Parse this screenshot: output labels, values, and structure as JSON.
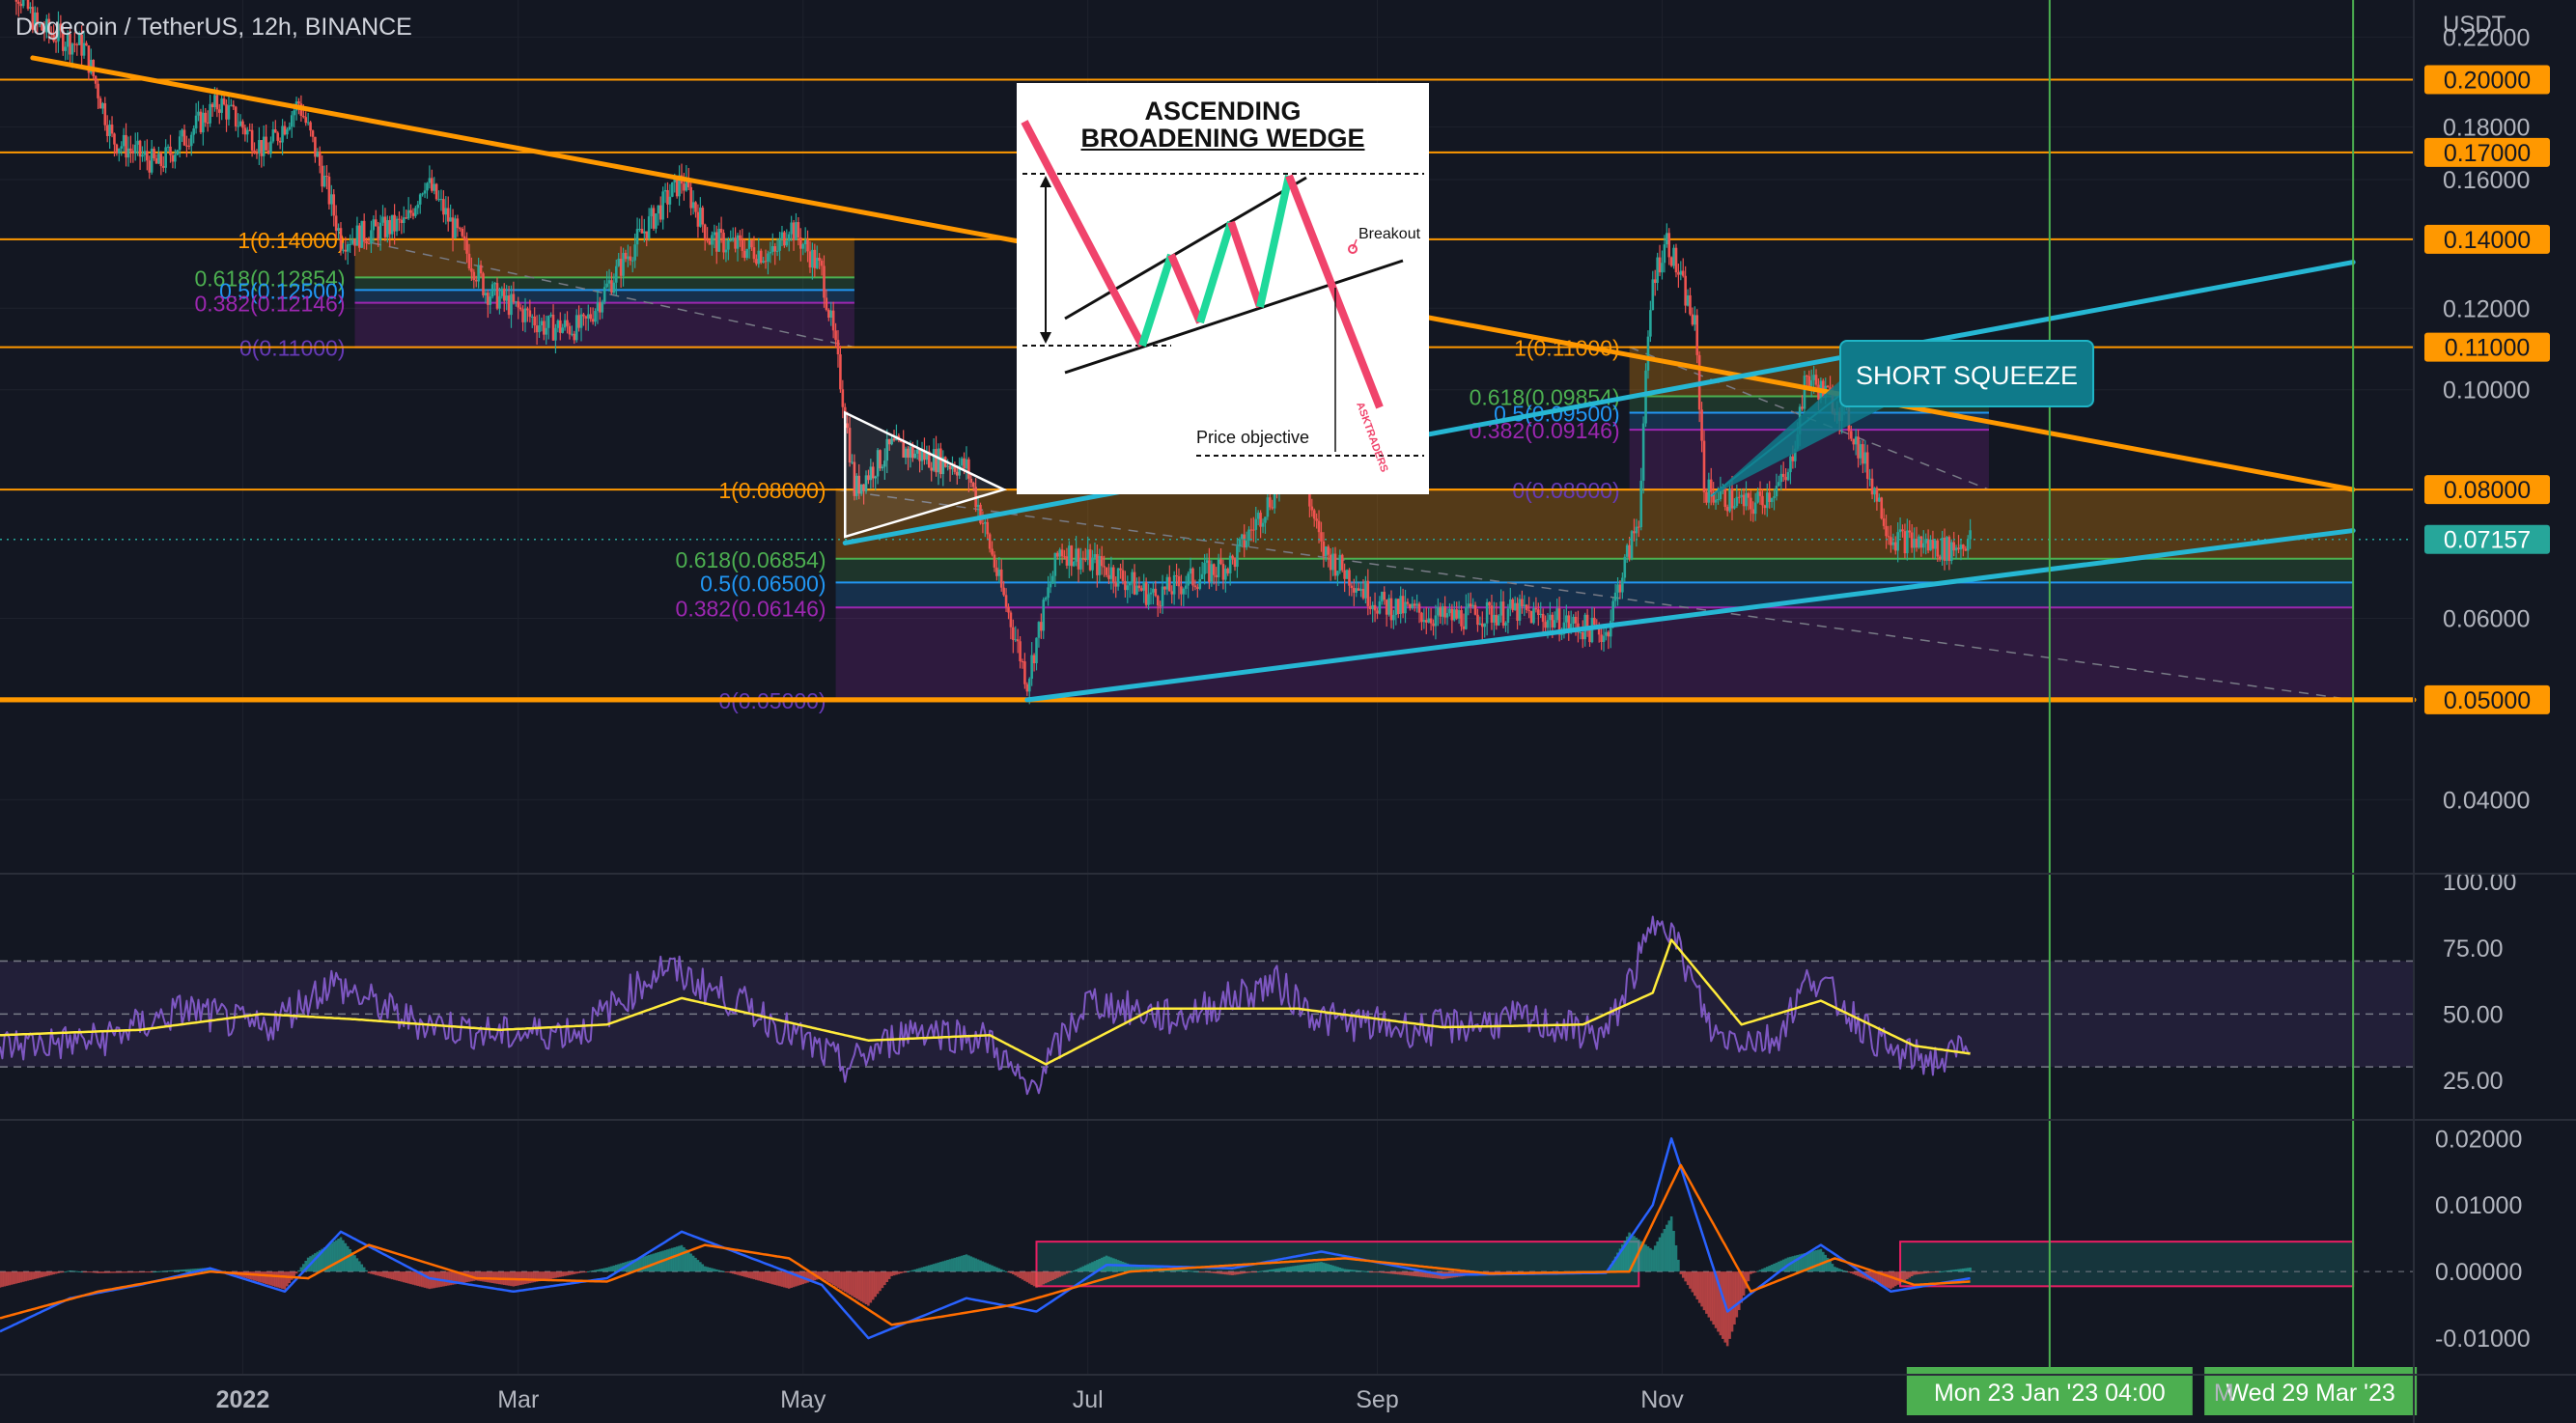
{
  "header": {
    "symbol_line": "Dogecoin / TetherUS, 12h, BINANCE",
    "currency": "USDT"
  },
  "callout": {
    "text": "SHORT SQUEEZE"
  },
  "inset": {
    "title_line1": "ASCENDING",
    "title_line2": "BROADENING WEDGE",
    "breakout_label": "Breakout",
    "objective_label": "Price objective",
    "watermark": "ASKTRADERS"
  },
  "colors": {
    "background": "#131722",
    "orange": "#ff9800",
    "cyan": "#26b7d4",
    "rsi": "#7e57c2",
    "rsi_ma": "#ffeb3b",
    "macd": "#2962ff",
    "signal": "#ff6d00",
    "up": "#26a69a",
    "down": "#ef5350",
    "green_vline": "#4caf50",
    "last_price": "#26a69a"
  },
  "chart_data": [
    {
      "type": "candlestick",
      "pane": "price",
      "title": "Dogecoin / TetherUS, 12h, BINANCE",
      "ylabel": "USDT",
      "scale": "log",
      "ylim": [
        0.0339,
        0.239
      ],
      "x_tick_labels": [
        "2022",
        "Mar",
        "May",
        "Jul",
        "Sep",
        "Nov"
      ],
      "x_date_range": [
        "2021-11-10",
        "2023-04-11"
      ],
      "y_tick_labels": [
        "0.22000",
        "0.18000",
        "0.16000",
        "0.12000",
        "0.10000",
        "0.06000",
        "0.04000"
      ],
      "price_level_badges": [
        "0.20000",
        "0.17000",
        "0.14000",
        "0.11000",
        "0.08000",
        "0.05000"
      ],
      "price_levels": [
        0.2,
        0.17,
        0.14,
        0.11,
        0.08,
        0.05
      ],
      "last_price": {
        "value": 0.07157,
        "label": "0.07157"
      },
      "close_series": [
        [
          "2021-11-10",
          0.26
        ],
        [
          "2021-11-18",
          0.225
        ],
        [
          "2021-11-28",
          0.215
        ],
        [
          "2021-12-04",
          0.175
        ],
        [
          "2021-12-14",
          0.165
        ],
        [
          "2021-12-27",
          0.19
        ],
        [
          "2022-01-06",
          0.17
        ],
        [
          "2022-01-13",
          0.19
        ],
        [
          "2022-01-22",
          0.14
        ],
        [
          "2022-02-05",
          0.145
        ],
        [
          "2022-02-09",
          0.16
        ],
        [
          "2022-02-22",
          0.125
        ],
        [
          "2022-03-07",
          0.115
        ],
        [
          "2022-03-15",
          0.115
        ],
        [
          "2022-03-29",
          0.145
        ],
        [
          "2022-04-05",
          0.16
        ],
        [
          "2022-04-11",
          0.14
        ],
        [
          "2022-04-25",
          0.135
        ],
        [
          "2022-04-28",
          0.145
        ],
        [
          "2022-05-05",
          0.13
        ],
        [
          "2022-05-10",
          0.095
        ],
        [
          "2022-05-12",
          0.08
        ],
        [
          "2022-05-20",
          0.088
        ],
        [
          "2022-06-05",
          0.084
        ],
        [
          "2022-06-12",
          0.065
        ],
        [
          "2022-06-18",
          0.052
        ],
        [
          "2022-06-25",
          0.07
        ],
        [
          "2022-07-05",
          0.067
        ],
        [
          "2022-07-15",
          0.063
        ],
        [
          "2022-08-01",
          0.068
        ],
        [
          "2022-08-15",
          0.086
        ],
        [
          "2022-08-20",
          0.07
        ],
        [
          "2022-09-01",
          0.062
        ],
        [
          "2022-09-15",
          0.06
        ],
        [
          "2022-10-01",
          0.061
        ],
        [
          "2022-10-20",
          0.058
        ],
        [
          "2022-10-27",
          0.075
        ],
        [
          "2022-10-30",
          0.128
        ],
        [
          "2022-11-02",
          0.14
        ],
        [
          "2022-11-08",
          0.115
        ],
        [
          "2022-11-10",
          0.08
        ],
        [
          "2022-11-20",
          0.077
        ],
        [
          "2022-11-28",
          0.082
        ],
        [
          "2022-12-02",
          0.103
        ],
        [
          "2022-12-10",
          0.095
        ],
        [
          "2022-12-20",
          0.072
        ],
        [
          "2023-01-01",
          0.07
        ],
        [
          "2023-01-06",
          0.07157
        ]
      ],
      "trendlines": [
        {
          "color": "orange",
          "points": [
            [
              "2021-11-17",
              0.21
            ],
            [
              "2023-03-29",
              0.08
            ]
          ]
        },
        {
          "color": "orange",
          "points": [
            [
              "2021-11-10",
              0.05
            ],
            [
              "2023-04-11",
              0.05
            ]
          ]
        },
        {
          "color": "cyan",
          "points": [
            [
              "2022-05-10",
              0.071
            ],
            [
              "2023-03-29",
              0.133
            ]
          ]
        },
        {
          "color": "cyan",
          "points": [
            [
              "2022-06-18",
              0.05
            ],
            [
              "2023-03-29",
              0.073
            ]
          ]
        }
      ],
      "fibonacci": [
        {
          "from": "2022-01-25",
          "to": "2022-05-12",
          "levels": [
            {
              "label": "1(0.14000)",
              "value": 0.14
            },
            {
              "label": "0.618(0.12854)",
              "value": 0.12854
            },
            {
              "label": "0.5(0.12500)",
              "value": 0.125
            },
            {
              "label": "0.382(0.12146)",
              "value": 0.12146
            },
            {
              "label": "0(0.11000)",
              "value": 0.11
            }
          ]
        },
        {
          "from": "2022-05-08",
          "to": "2023-03-29",
          "levels": [
            {
              "label": "1(0.08000)",
              "value": 0.08
            },
            {
              "label": "0.618(0.06854)",
              "value": 0.06854
            },
            {
              "label": "0.5(0.06500)",
              "value": 0.065
            },
            {
              "label": "0.382(0.06146)",
              "value": 0.06146
            },
            {
              "label": "0(0.05000)",
              "value": 0.05
            }
          ]
        },
        {
          "from": "2022-10-25",
          "to": "2023-01-10",
          "levels": [
            {
              "label": "1(0.11000)",
              "value": 0.11
            },
            {
              "label": "0.618(0.09854)",
              "value": 0.09854
            },
            {
              "label": "0.5(0.09500)",
              "value": 0.095
            },
            {
              "label": "0.382(0.09146)",
              "value": 0.09146
            },
            {
              "label": "0(0.08000)",
              "value": 0.08
            }
          ]
        }
      ],
      "markers": {
        "vertical_lines": [
          "2023-01-23",
          "2023-03-29"
        ],
        "time_labels": [
          "Mon 23 Jan '23   04:00",
          "Wed 29 Mar '23"
        ],
        "partial_label": "M"
      }
    },
    {
      "type": "line",
      "pane": "rsi",
      "ylim": [
        10,
        103
      ],
      "y_tick_labels": [
        "100.00",
        "75.00",
        "50.00",
        "25.00"
      ],
      "bands": [
        30,
        50,
        70
      ],
      "series": [
        {
          "role": "rsi",
          "values": [
            [
              "2021-11-10",
              38
            ],
            [
              "2021-12-01",
              40
            ],
            [
              "2021-12-20",
              52
            ],
            [
              "2022-01-05",
              44
            ],
            [
              "2022-01-20",
              62
            ],
            [
              "2022-02-05",
              48
            ],
            [
              "2022-02-25",
              42
            ],
            [
              "2022-03-15",
              44
            ],
            [
              "2022-04-01",
              68
            ],
            [
              "2022-04-20",
              52
            ],
            [
              "2022-05-10",
              30
            ],
            [
              "2022-05-25",
              45
            ],
            [
              "2022-06-10",
              40
            ],
            [
              "2022-06-18",
              20
            ],
            [
              "2022-07-01",
              55
            ],
            [
              "2022-07-20",
              48
            ],
            [
              "2022-08-10",
              62
            ],
            [
              "2022-08-20",
              48
            ],
            [
              "2022-09-10",
              44
            ],
            [
              "2022-10-01",
              48
            ],
            [
              "2022-10-20",
              42
            ],
            [
              "2022-11-01",
              90
            ],
            [
              "2022-11-12",
              42
            ],
            [
              "2022-11-25",
              40
            ],
            [
              "2022-12-03",
              65
            ],
            [
              "2022-12-20",
              35
            ],
            [
              "2023-01-01",
              32
            ],
            [
              "2023-01-06",
              42
            ]
          ]
        },
        {
          "role": "rsi_ma",
          "values": [
            [
              "2021-11-10",
              42
            ],
            [
              "2021-12-10",
              44
            ],
            [
              "2022-01-05",
              50
            ],
            [
              "2022-01-25",
              48
            ],
            [
              "2022-02-25",
              44
            ],
            [
              "2022-03-20",
              46
            ],
            [
              "2022-04-05",
              56
            ],
            [
              "2022-04-25",
              48
            ],
            [
              "2022-05-15",
              40
            ],
            [
              "2022-06-10",
              42
            ],
            [
              "2022-06-22",
              31
            ],
            [
              "2022-07-15",
              52
            ],
            [
              "2022-08-15",
              52
            ],
            [
              "2022-09-15",
              45
            ],
            [
              "2022-10-15",
              46
            ],
            [
              "2022-10-30",
              58
            ],
            [
              "2022-11-03",
              78
            ],
            [
              "2022-11-18",
              46
            ],
            [
              "2022-12-05",
              55
            ],
            [
              "2022-12-25",
              38
            ],
            [
              "2023-01-06",
              35
            ]
          ]
        }
      ]
    },
    {
      "type": "line",
      "pane": "macd",
      "ylim": [
        -0.0155,
        0.0228
      ],
      "y_tick_labels": [
        "0.02000",
        "0.01000",
        "0.00000",
        "-0.01000"
      ],
      "series": [
        {
          "role": "macd",
          "values": [
            [
              "2021-11-10",
              -0.009
            ],
            [
              "2021-11-25",
              -0.004
            ],
            [
              "2021-12-10",
              -0.002
            ],
            [
              "2021-12-25",
              0.0005
            ],
            [
              "2022-01-10",
              -0.003
            ],
            [
              "2022-01-22",
              0.006
            ],
            [
              "2022-02-10",
              -0.001
            ],
            [
              "2022-02-28",
              -0.003
            ],
            [
              "2022-03-20",
              -0.001
            ],
            [
              "2022-04-05",
              0.006
            ],
            [
              "2022-04-20",
              0.002
            ],
            [
              "2022-05-05",
              -0.002
            ],
            [
              "2022-05-15",
              -0.01
            ],
            [
              "2022-06-05",
              -0.004
            ],
            [
              "2022-06-20",
              -0.006
            ],
            [
              "2022-07-05",
              0.001
            ],
            [
              "2022-08-01",
              0.0005
            ],
            [
              "2022-08-20",
              0.003
            ],
            [
              "2022-09-15",
              -0.0005
            ],
            [
              "2022-10-20",
              -0.0002
            ],
            [
              "2022-10-30",
              0.01
            ],
            [
              "2022-11-03",
              0.02
            ],
            [
              "2022-11-15",
              -0.006
            ],
            [
              "2022-11-28",
              0.001
            ],
            [
              "2022-12-05",
              0.004
            ],
            [
              "2022-12-20",
              -0.003
            ],
            [
              "2023-01-06",
              -0.001
            ]
          ]
        },
        {
          "role": "signal",
          "values": [
            [
              "2021-11-10",
              -0.007
            ],
            [
              "2021-12-01",
              -0.003
            ],
            [
              "2021-12-25",
              0.0
            ],
            [
              "2022-01-15",
              -0.001
            ],
            [
              "2022-01-28",
              0.004
            ],
            [
              "2022-02-20",
              -0.001
            ],
            [
              "2022-03-20",
              -0.0015
            ],
            [
              "2022-04-10",
              0.004
            ],
            [
              "2022-04-28",
              0.002
            ],
            [
              "2022-05-20",
              -0.008
            ],
            [
              "2022-06-15",
              -0.005
            ],
            [
              "2022-07-10",
              0.0
            ],
            [
              "2022-08-25",
              0.002
            ],
            [
              "2022-09-25",
              -0.0003
            ],
            [
              "2022-10-25",
              0.0
            ],
            [
              "2022-11-05",
              0.016
            ],
            [
              "2022-11-20",
              -0.003
            ],
            [
              "2022-12-08",
              0.002
            ],
            [
              "2022-12-25",
              -0.002
            ],
            [
              "2023-01-06",
              -0.0015
            ]
          ]
        }
      ],
      "highlight_boxes": [
        {
          "from": "2022-06-20",
          "to": "2022-10-27",
          "ylim": [
            -0.0022,
            0.0045
          ]
        },
        {
          "from": "2022-12-22",
          "to": "2023-03-29",
          "ylim": [
            -0.0022,
            0.0045
          ]
        }
      ]
    }
  ]
}
